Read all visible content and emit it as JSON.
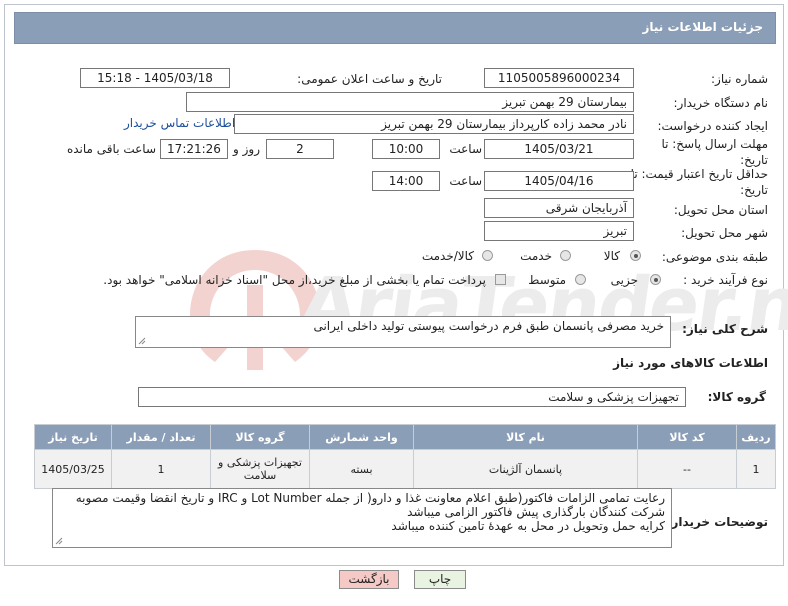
{
  "header": {
    "title": "جزئیات اطلاعات نیاز"
  },
  "fields": {
    "need_number_label": "شماره نیاز:",
    "need_number": "1105005896000234",
    "announce_label": "تاریخ و ساعت اعلان عمومی:",
    "announce_value": "1405/03/18 - 15:18",
    "buyer_org_label": "نام دستگاه خریدار:",
    "buyer_org": "بیمارستان 29 بهمن تبریز",
    "requester_label": "ایجاد کننده درخواست:",
    "requester": "نادر محمد زاده کارپرداز بیمارستان 29 بهمن تبریز",
    "contact_link": "اطلاعات تماس خریدار",
    "deadline_label": "مهلت ارسال پاسخ: تا تاریخ:",
    "deadline_date": "1405/03/21",
    "time_label": "ساعت",
    "deadline_time": "10:00",
    "days_value": "2",
    "days_label": "روز و",
    "remaining_time": "17:21:26",
    "remaining_label": "ساعت باقی مانده",
    "validity_label": "حداقل تاریخ اعتبار قیمت: تا تاریخ:",
    "validity_date": "1405/04/16",
    "validity_time": "14:00",
    "province_label": "استان محل تحویل:",
    "province": "آذربایجان شرقی",
    "city_label": "شهر محل تحویل:",
    "city": "تبریز",
    "category_label": "طبقه بندی موضوعی:",
    "category_options": [
      "کالا",
      "خدمت",
      "کالا/خدمت"
    ],
    "process_label": "نوع فرآیند خرید :",
    "process_options": [
      "جزیی",
      "متوسط"
    ],
    "payment_note": "پرداخت تمام یا بخشی از مبلغ خرید،از محل \"اسناد خزانه اسلامی\" خواهد بود."
  },
  "description": {
    "label": "شرح کلی نیاز:",
    "text": "خرید مصرفی پانسمان طبق فرم درخواست پیوستی  تولید داخلی ایرانی"
  },
  "goods": {
    "section_title": "اطلاعات کالاهای مورد نیاز",
    "group_label": "گروه کالا:",
    "group_value": "تجهیزات پزشکی و سلامت",
    "columns": [
      "ردیف",
      "کد کالا",
      "نام کالا",
      "واحد شمارش",
      "گروه کالا",
      "تعداد / مقدار",
      "تاریخ نیاز"
    ],
    "rows": [
      [
        "1",
        "--",
        "پانسمان آلژینات",
        "بسته",
        "تجهیزات پزشکی و سلامت",
        "1",
        "1405/03/25"
      ]
    ]
  },
  "buyer_notes": {
    "label": "توضیحات خریدار:",
    "lines": [
      "رعایت تمامی الزامات فاکتور(طبق اعلام معاونت غذا و دارو( از جمله Lot Number و IRC و تاریخ انقضا وقیمت مصوبه",
      "شرکت کنندگان بارگذاری پیش فاکتور الزامی میباشد",
      "کرایه حمل وتحویل در محل به عهدهٔ تامین کننده میباشد"
    ]
  },
  "buttons": {
    "print": "چاپ",
    "back": "بازگشت"
  },
  "colors": {
    "header_bg": "#8b9eb7",
    "back_btn_bg": "#f4c9c6",
    "print_btn_bg": "#e8f3e2",
    "link": "#1d4f9c"
  }
}
